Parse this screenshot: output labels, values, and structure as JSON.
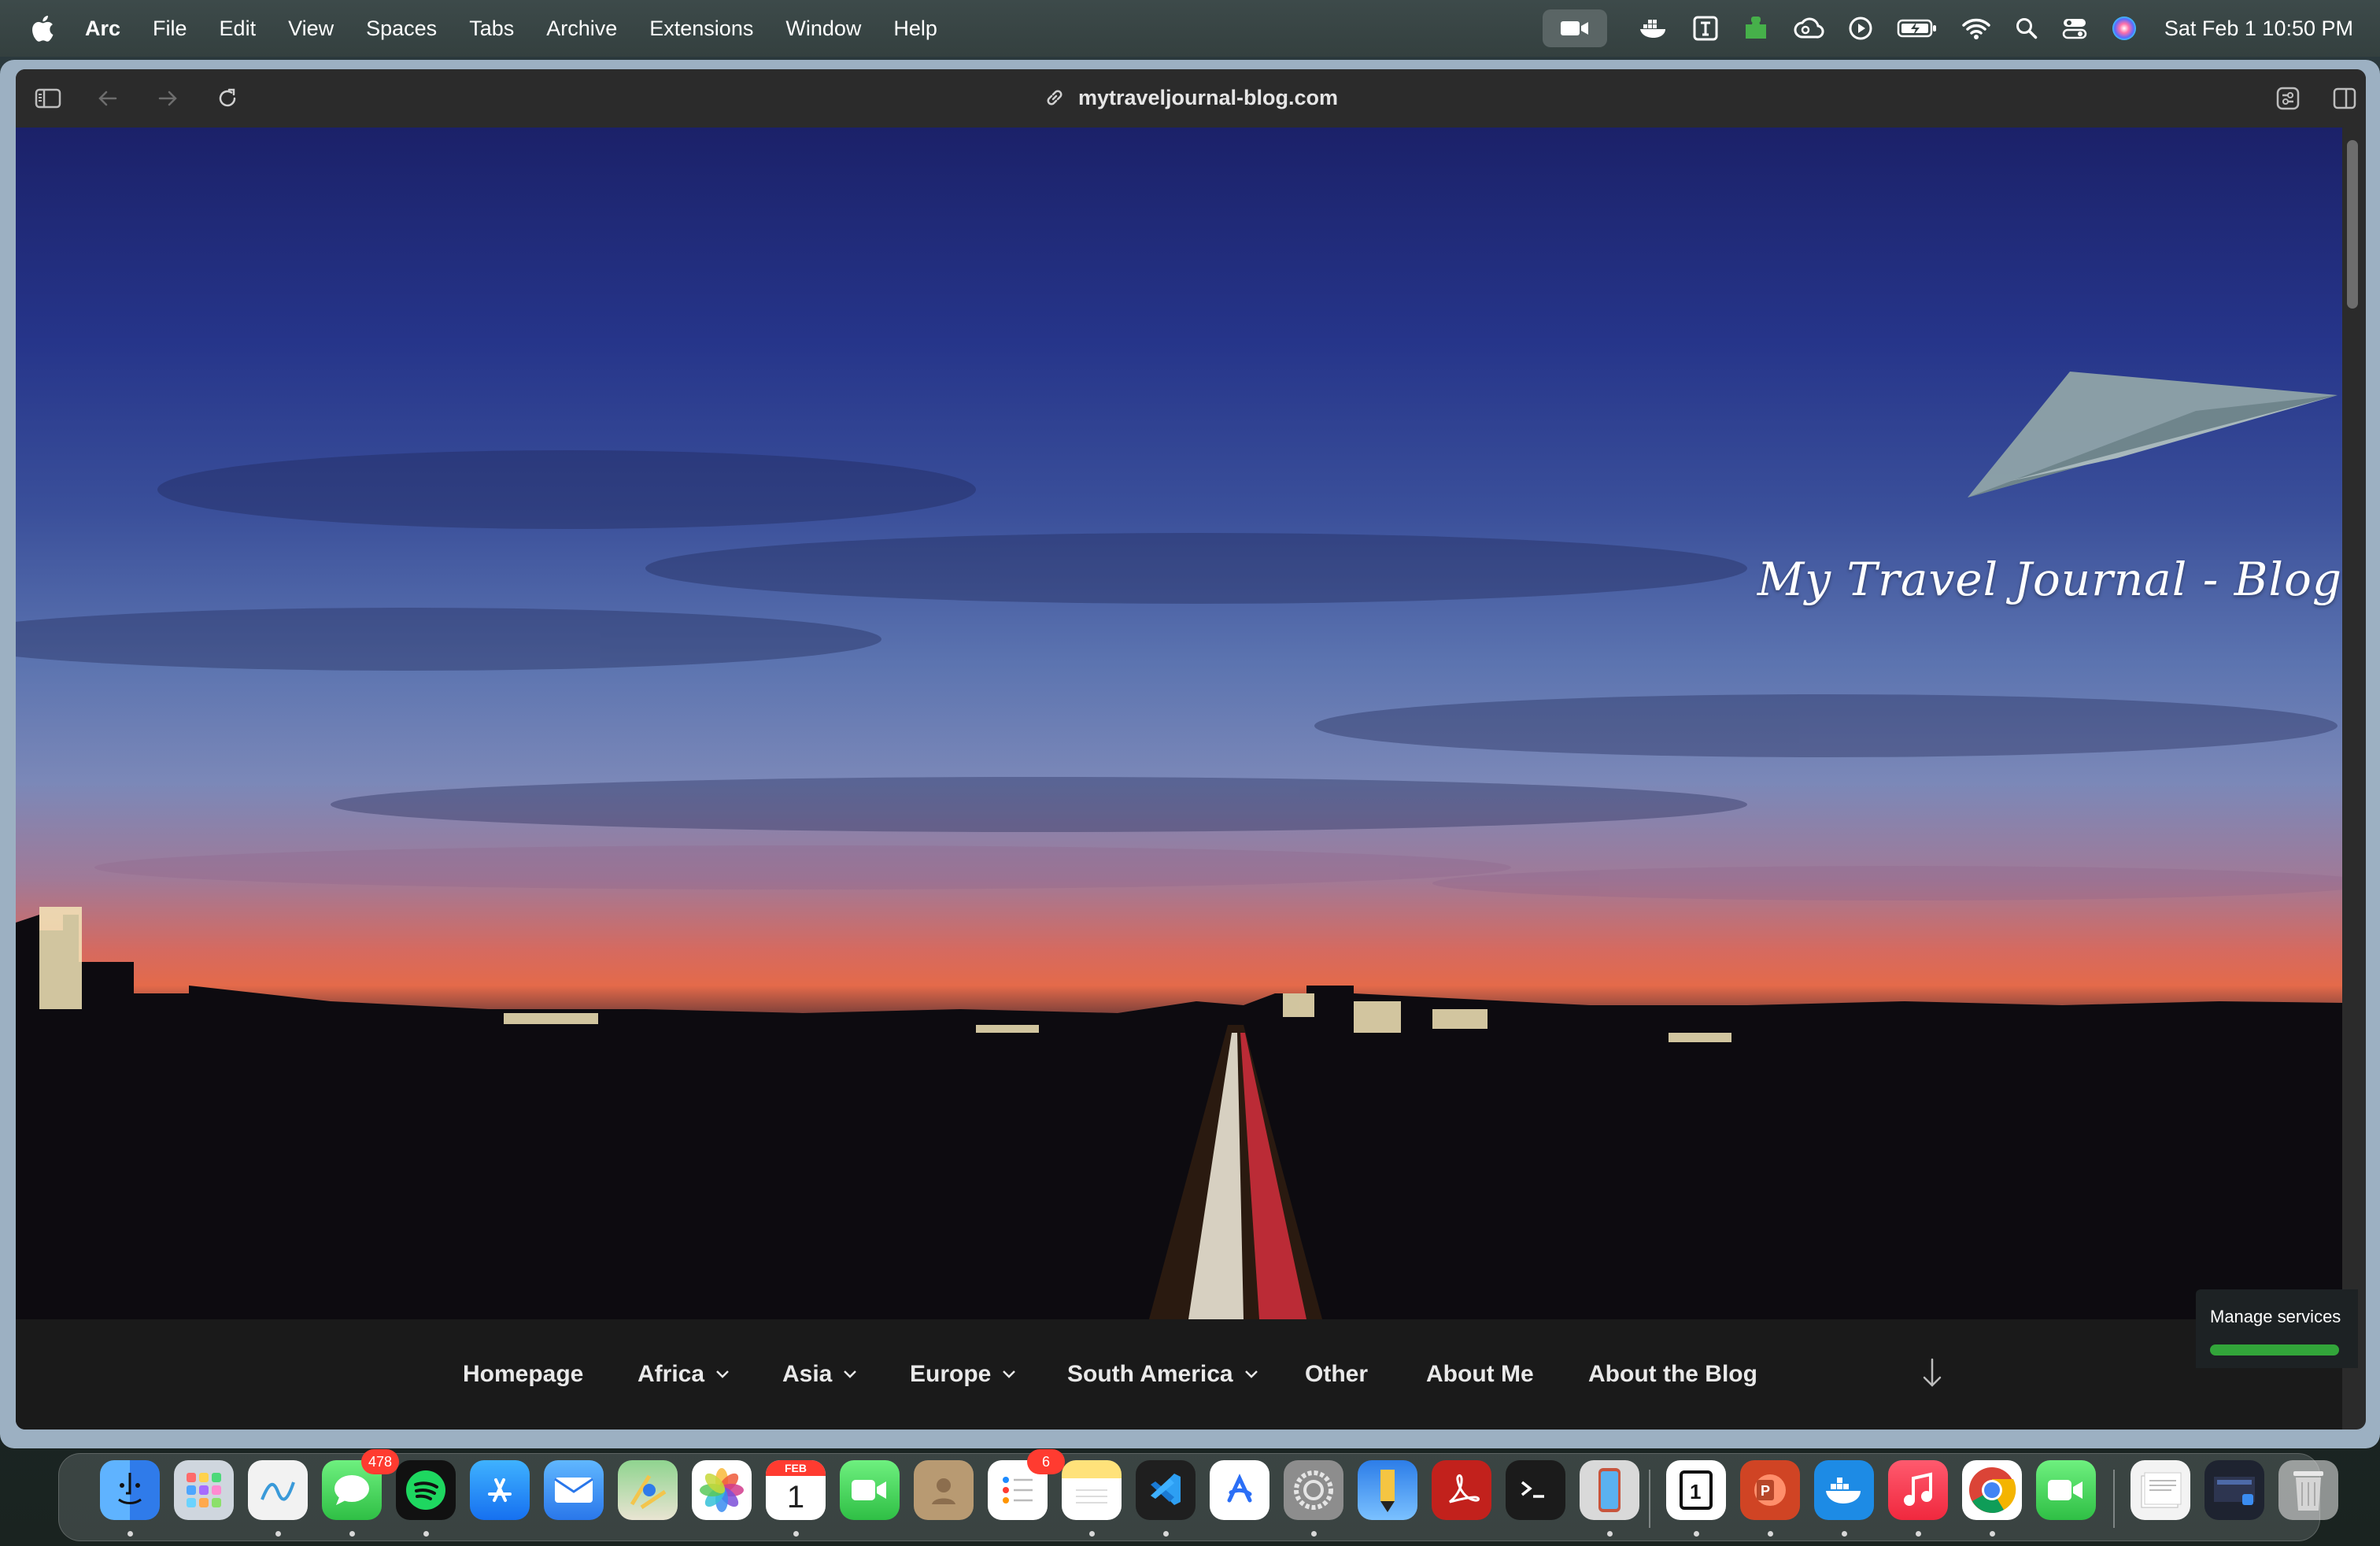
{
  "menubar": {
    "apple_icon": "apple-logo-icon",
    "items": [
      {
        "label": "Arc"
      },
      {
        "label": "File"
      },
      {
        "label": "Edit"
      },
      {
        "label": "View"
      },
      {
        "label": "Spaces"
      },
      {
        "label": "Tabs"
      },
      {
        "label": "Archive"
      },
      {
        "label": "Extensions"
      },
      {
        "label": "Window"
      },
      {
        "label": "Help"
      }
    ],
    "status_icons": [
      "camera-icon",
      "docker-icon",
      "text-box-icon",
      "puzzle-icon",
      "creative-cloud-icon",
      "play-icon",
      "battery-charging-icon",
      "wifi-icon",
      "search-icon",
      "control-center-icon",
      "siri-icon"
    ],
    "clock": "Sat Feb 1  10:50 PM"
  },
  "browser": {
    "url": "mytraveljournal-blog.com"
  },
  "site": {
    "logo_text": "My Travel Journal - Blog",
    "nav": [
      {
        "label": "Homepage",
        "has_menu": false
      },
      {
        "label": "Africa",
        "has_menu": true
      },
      {
        "label": "Asia",
        "has_menu": true
      },
      {
        "label": "Europe",
        "has_menu": true
      },
      {
        "label": "South America",
        "has_menu": true
      },
      {
        "label": "Other",
        "has_menu": false
      },
      {
        "label": "About Me",
        "has_menu": false
      },
      {
        "label": "About the Blog",
        "has_menu": false
      }
    ],
    "manage_services": "Manage services"
  },
  "dock": {
    "apps": [
      {
        "name": "finder-icon",
        "badge": ""
      },
      {
        "name": "launchpad-icon",
        "badge": ""
      },
      {
        "name": "freeform-icon",
        "badge": ""
      },
      {
        "name": "messages-icon",
        "badge": "478"
      },
      {
        "name": "spotify-icon",
        "badge": ""
      },
      {
        "name": "app-store-icon",
        "badge": ""
      },
      {
        "name": "mail-icon",
        "badge": ""
      },
      {
        "name": "maps-icon",
        "badge": ""
      },
      {
        "name": "photos-icon",
        "badge": ""
      },
      {
        "name": "calendar-icon",
        "badge": "",
        "month": "FEB",
        "day": "1"
      },
      {
        "name": "facetime-icon",
        "badge": ""
      },
      {
        "name": "contacts-icon",
        "badge": ""
      },
      {
        "name": "reminders-icon",
        "badge": "6"
      },
      {
        "name": "notes-icon",
        "badge": ""
      },
      {
        "name": "vscode-icon",
        "badge": ""
      },
      {
        "name": "arc-icon",
        "badge": ""
      },
      {
        "name": "system-settings-icon",
        "badge": ""
      },
      {
        "name": "pencil-app-icon",
        "badge": ""
      },
      {
        "name": "acrobat-icon",
        "badge": ""
      },
      {
        "name": "terminal-icon",
        "badge": ""
      },
      {
        "name": "iphone-mirroring-icon",
        "badge": ""
      },
      {
        "name": "one-password-icon",
        "badge": ""
      },
      {
        "name": "powerpoint-icon",
        "badge": ""
      },
      {
        "name": "docker-app-icon",
        "badge": ""
      },
      {
        "name": "music-icon",
        "badge": ""
      },
      {
        "name": "chrome-icon",
        "badge": ""
      },
      {
        "name": "facetime-2-icon",
        "badge": ""
      },
      {
        "name": "documents-stack-icon",
        "badge": ""
      },
      {
        "name": "screenshot-stack-icon",
        "badge": ""
      },
      {
        "name": "trash-icon",
        "badge": ""
      }
    ]
  }
}
